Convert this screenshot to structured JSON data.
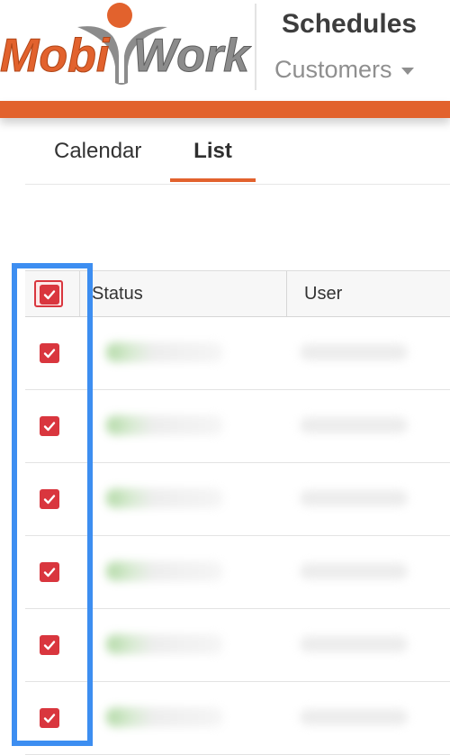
{
  "brand": {
    "name_part1": "Mobi",
    "name_part2": "Work",
    "colors": {
      "orange": "#e2622d",
      "gray": "#8c8c8c",
      "checkbox_red": "#d9363e",
      "highlight_blue": "#3d8ef1"
    }
  },
  "header": {
    "title": "Schedules",
    "dropdown_label": "Customers",
    "dropdown_icon": "caret-down-icon"
  },
  "tabs": [
    {
      "label": "Calendar",
      "active": false
    },
    {
      "label": "List",
      "active": true
    }
  ],
  "table": {
    "select_all_checked": true,
    "columns": [
      "Status",
      "User"
    ],
    "rows": [
      {
        "checked": true,
        "status": "",
        "user": ""
      },
      {
        "checked": true,
        "status": "",
        "user": ""
      },
      {
        "checked": true,
        "status": "",
        "user": ""
      },
      {
        "checked": true,
        "status": "",
        "user": ""
      },
      {
        "checked": true,
        "status": "",
        "user": ""
      },
      {
        "checked": true,
        "status": "",
        "user": ""
      }
    ]
  }
}
